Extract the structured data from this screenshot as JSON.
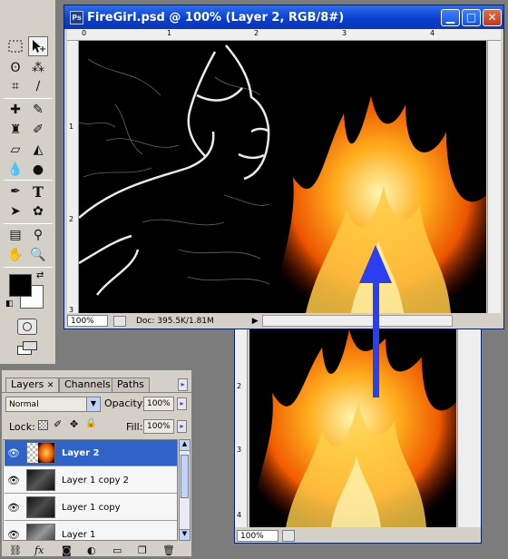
{
  "doc_window": {
    "title": "FireGirl.psd @ 100% (Layer 2, RGB/8#)",
    "ruler_h": [
      "0",
      "1",
      "2",
      "3",
      "4"
    ],
    "ruler_v": [
      "1",
      "2",
      "3"
    ],
    "zoom": "100%",
    "doc_info": "Doc: 395.5K/1.81M"
  },
  "fire_window": {
    "ruler_v": [
      "2",
      "3",
      "4"
    ],
    "zoom": "100%"
  },
  "layers_panel": {
    "tabs": [
      "Layers",
      "Channels",
      "Paths"
    ],
    "blend_mode": "Normal",
    "opacity_label": "Opacity:",
    "opacity_value": "100%",
    "lock_label": "Lock:",
    "fill_label": "Fill:",
    "fill_value": "100%",
    "layers": [
      {
        "name": "Layer 2",
        "active": true
      },
      {
        "name": "Layer 1 copy 2",
        "active": false
      },
      {
        "name": "Layer 1 copy",
        "active": false
      },
      {
        "name": "Layer 1",
        "active": false
      }
    ]
  },
  "colors": {
    "foreground": "#000000",
    "background": "#ffffff",
    "title_bar": "#0b3fcf",
    "drag_arrow": "#2a3ff0",
    "active_layer": "#3063c7"
  },
  "icons": [
    "move-icon",
    "marquee-icon",
    "lasso-icon",
    "magic-wand-icon",
    "crop-icon",
    "brush-icon",
    "eraser-icon",
    "text-icon",
    "eye-icon",
    "lock-icon"
  ]
}
